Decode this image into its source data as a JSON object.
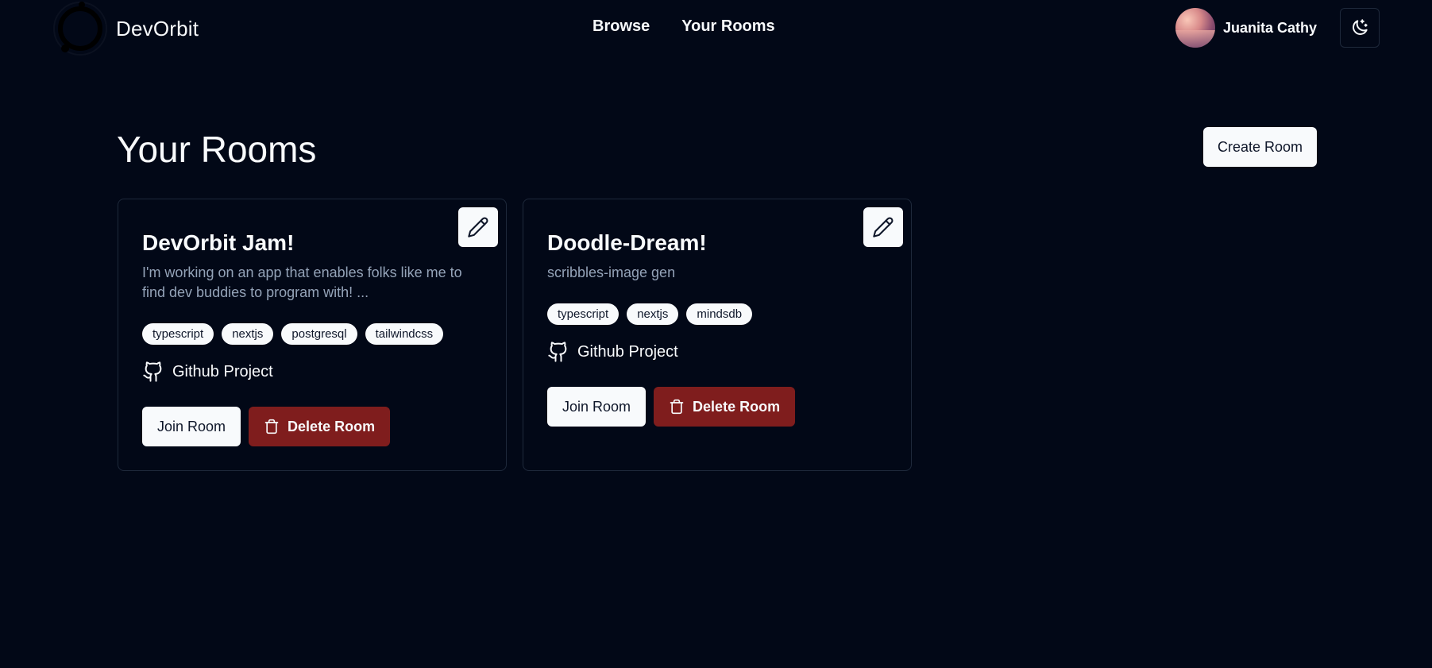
{
  "header": {
    "brand": "DevOrbit",
    "nav": [
      {
        "label": "Browse"
      },
      {
        "label": "Your Rooms"
      }
    ],
    "user": {
      "name": "Juanita Cathy"
    }
  },
  "main": {
    "title": "Your Rooms",
    "create_button": "Create Room"
  },
  "rooms": [
    {
      "title": "DevOrbit Jam!",
      "description": "I'm working on an app that enables folks like me to find dev buddies to program with! ...",
      "tags": [
        "typescript",
        "nextjs",
        "postgresql",
        "tailwindcss"
      ],
      "github_label": "Github Project",
      "join_label": "Join Room",
      "delete_label": "Delete Room"
    },
    {
      "title": "Doodle-Dream!",
      "description": "scribbles-image gen",
      "tags": [
        "typescript",
        "nextjs",
        "mindsdb"
      ],
      "github_label": "Github Project",
      "join_label": "Join Room",
      "delete_label": "Delete Room"
    }
  ],
  "colors": {
    "background": "#020817",
    "foreground": "#f8fafc",
    "muted": "#94a3b8",
    "destructive": "#7f1d1d",
    "border": "#1e293b"
  }
}
